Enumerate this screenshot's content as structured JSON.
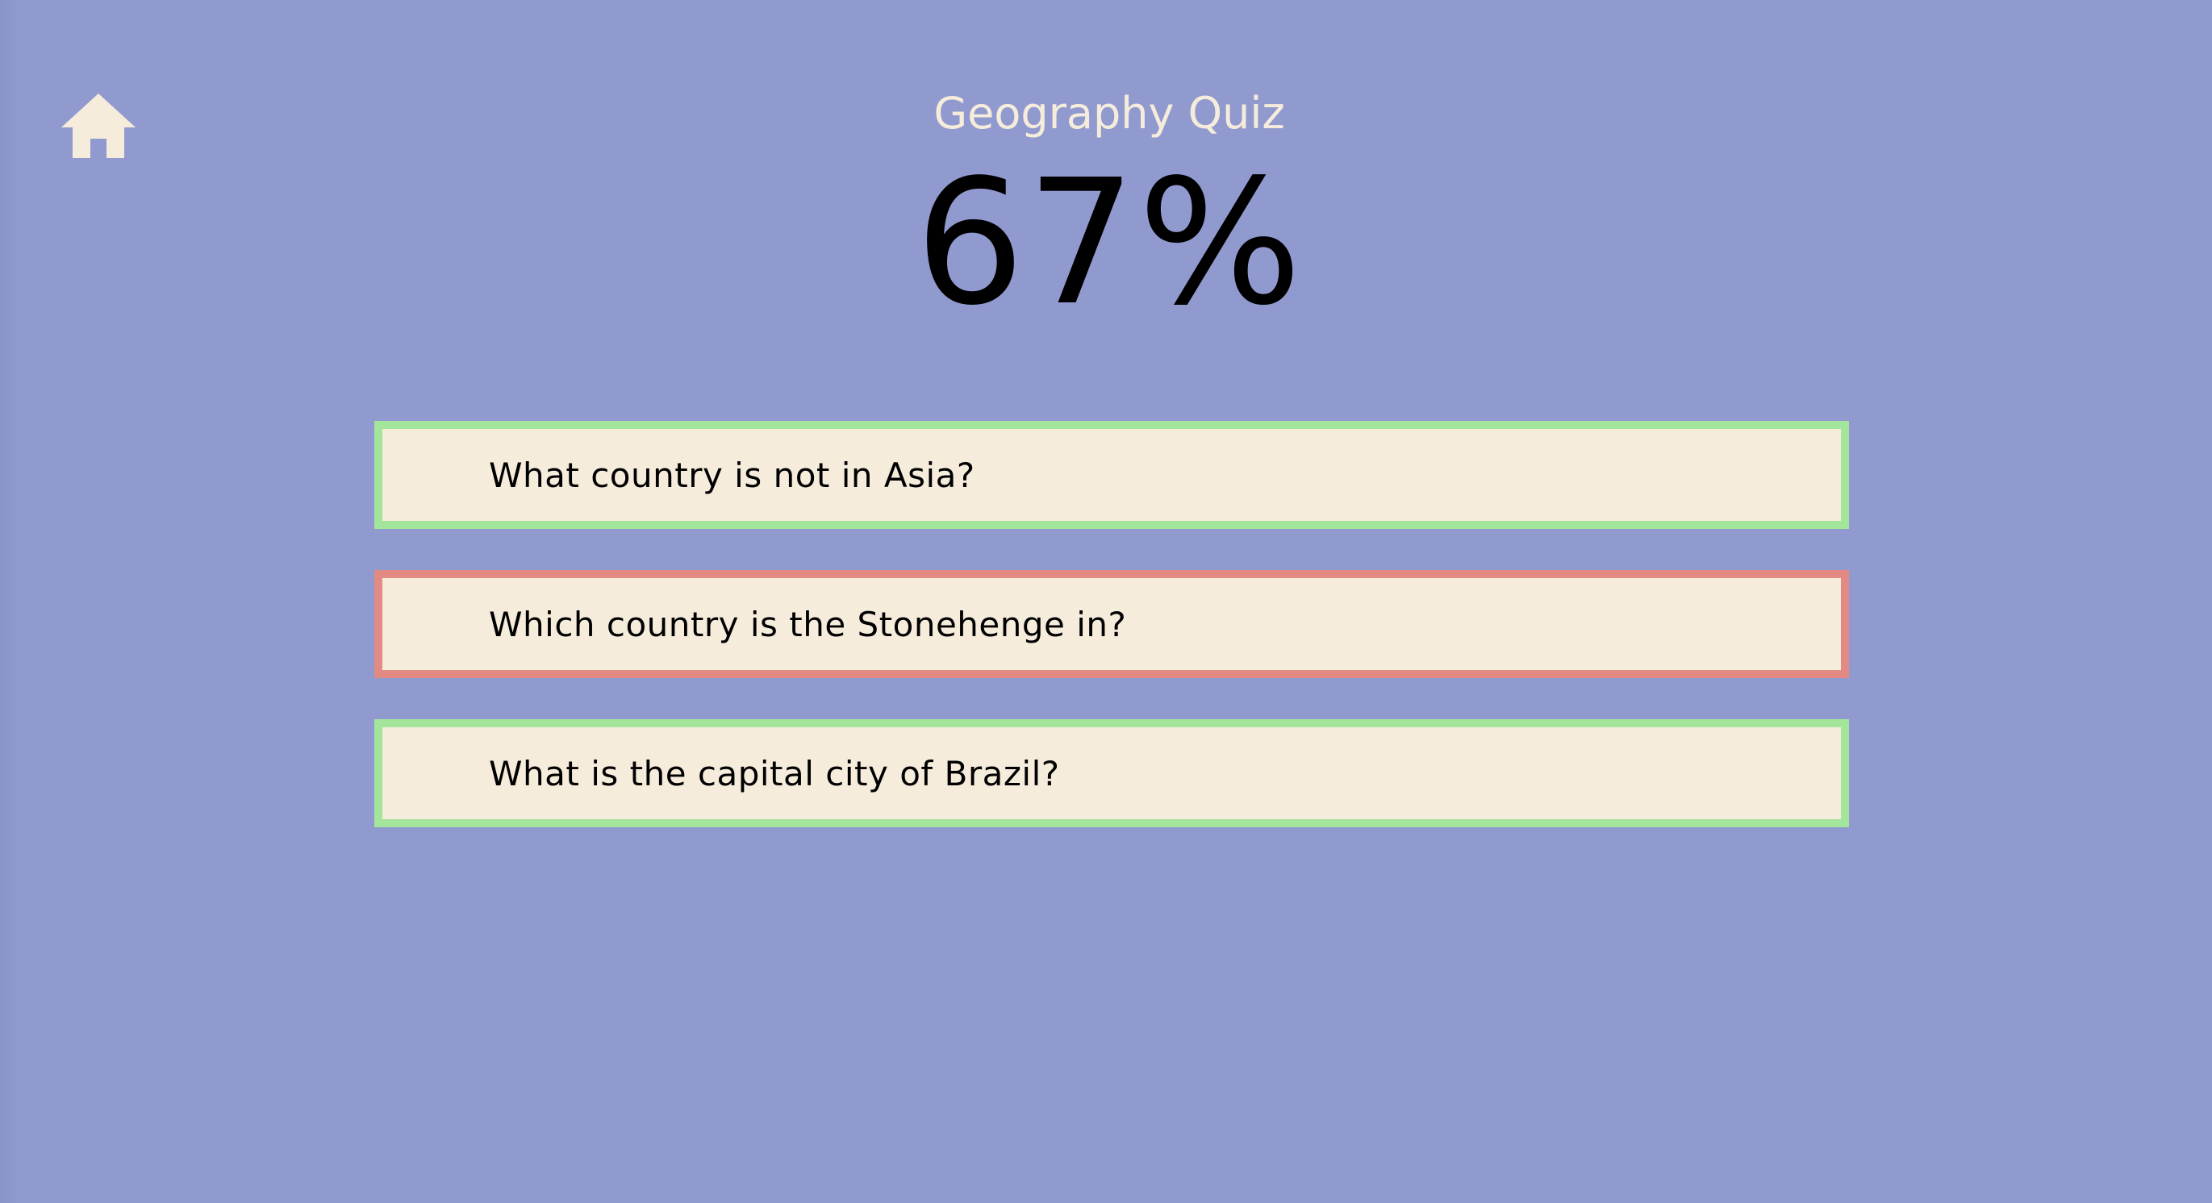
{
  "quiz": {
    "title": "Geography Quiz",
    "score": "67%"
  },
  "home": {
    "icon": "home-icon"
  },
  "colors": {
    "background": "#919acf",
    "card": "#f6ecdc",
    "correct": "#a4e59c",
    "incorrect": "#e38a84",
    "title_text": "#f6ecdc"
  },
  "questions": [
    {
      "text": "What country is not in Asia?",
      "result": "correct"
    },
    {
      "text": "Which country is the Stonehenge in?",
      "result": "incorrect"
    },
    {
      "text": "What is the capital city of Brazil?",
      "result": "correct"
    }
  ]
}
